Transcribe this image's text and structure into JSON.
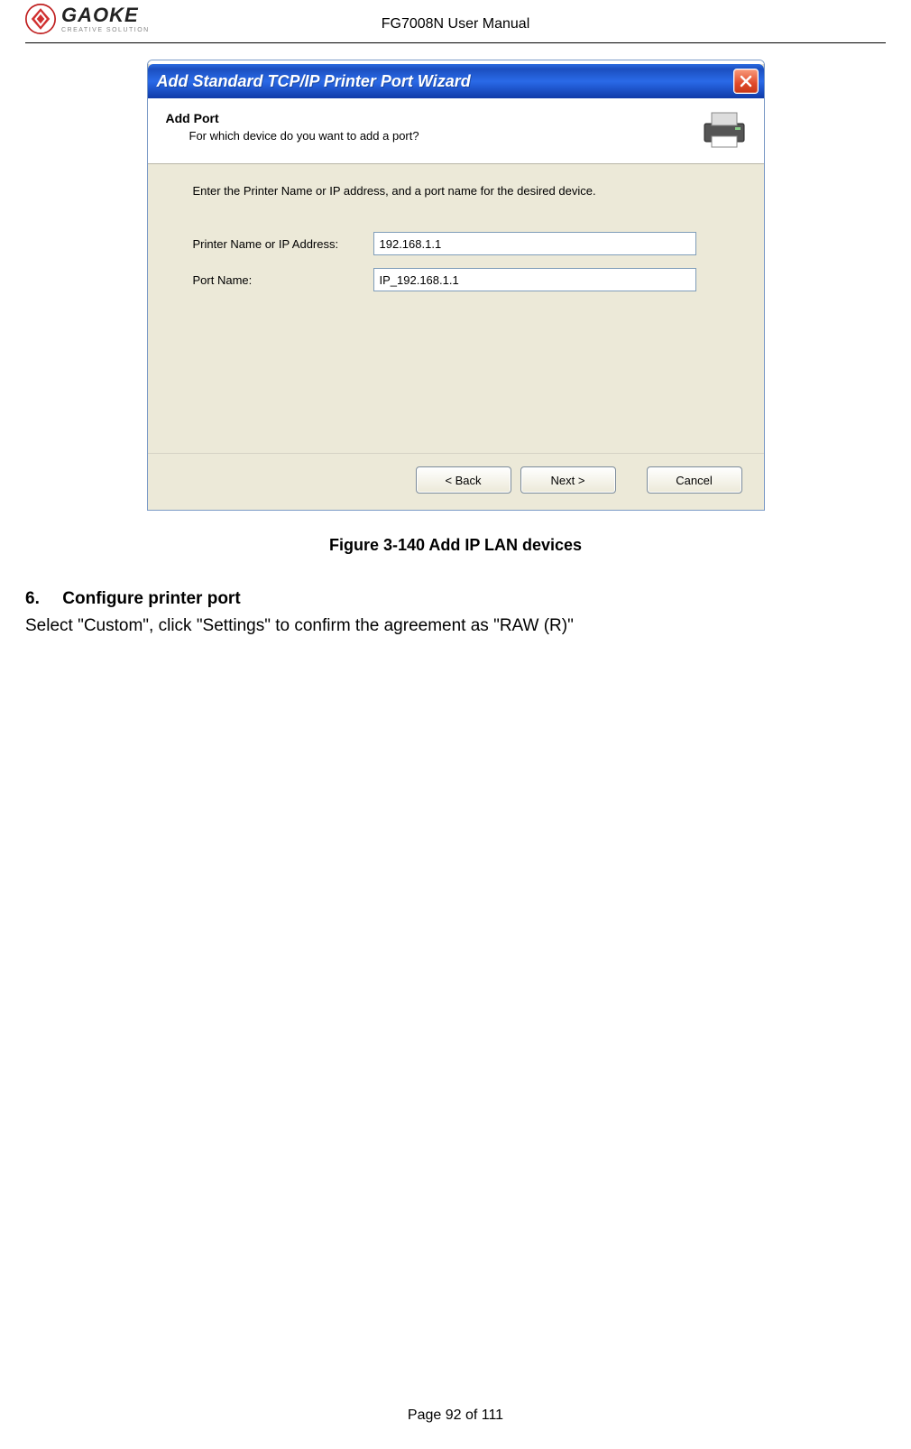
{
  "header": {
    "logo_main": "GAOKE",
    "logo_sub": "CREATIVE SOLUTION",
    "doc_title": "FG7008N User Manual"
  },
  "wizard": {
    "title": "Add Standard TCP/IP Printer Port Wizard",
    "header_title": "Add Port",
    "header_sub": "For which device do you want to add a port?",
    "intro": "Enter the Printer Name or IP address, and a port name for the desired device.",
    "label_printer": "Printer Name or IP Address:",
    "label_port": "Port Name:",
    "value_printer": "192.168.1.1",
    "value_port": "IP_192.168.1.1",
    "btn_back": "< Back",
    "btn_next": "Next >",
    "btn_cancel": "Cancel"
  },
  "figure_caption": "Figure 3-140  Add IP LAN devices",
  "section": {
    "number": "6.",
    "title": "Configure printer port",
    "body": "Select \"Custom\", click \"Settings\" to confirm the agreement as \"RAW (R)\""
  },
  "footer": "Page 92 of 111"
}
